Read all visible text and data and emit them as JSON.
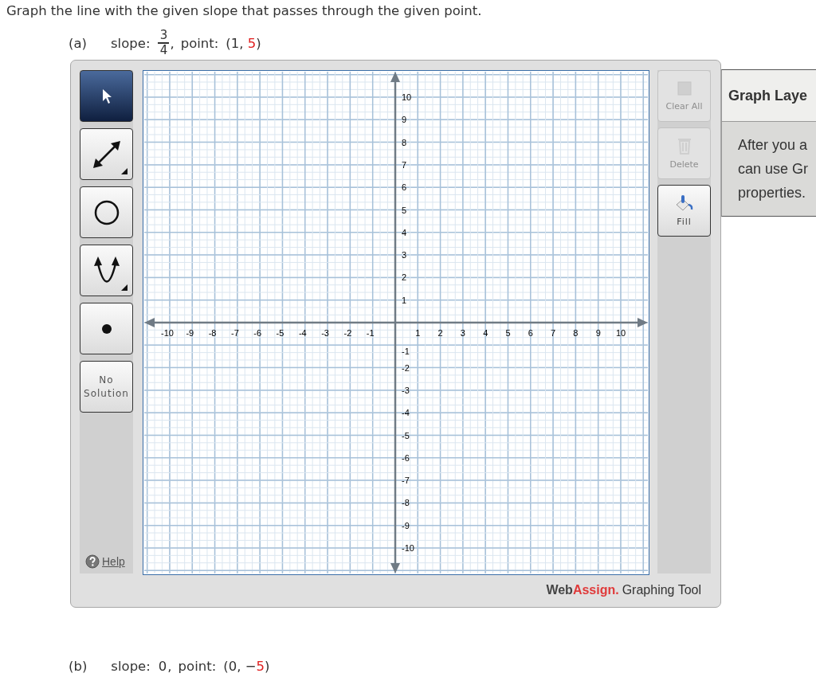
{
  "instruction": "Graph the line with the given slope that passes through the given point.",
  "parts": [
    {
      "label": "(a)",
      "slope_label": "slope:",
      "slope": {
        "kind": "fraction",
        "numerator": "3",
        "denominator": "4"
      },
      "separator": ",",
      "point_label": "point:",
      "point": {
        "open": "(1, ",
        "highlight": "5",
        "close": ")"
      }
    },
    {
      "label": "(b)",
      "slope_label": "slope:",
      "slope": {
        "kind": "number",
        "text": "0"
      },
      "separator": ",",
      "point_label": "point:",
      "point": {
        "open": "(0, −",
        "highlight": "5",
        "close": ")"
      }
    }
  ],
  "tool": {
    "tools": [
      {
        "kind": "pointer",
        "selected": true,
        "has_menu": false
      },
      {
        "kind": "line",
        "selected": false,
        "has_menu": true
      },
      {
        "kind": "circle",
        "selected": false,
        "has_menu": false
      },
      {
        "kind": "parabola",
        "selected": false,
        "has_menu": true
      },
      {
        "kind": "point",
        "selected": false,
        "has_menu": false
      },
      {
        "kind": "text",
        "label": "No Solution",
        "selected": false,
        "has_menu": false
      }
    ],
    "help": "Help",
    "actions": [
      {
        "kind": "clear",
        "label": "Clear All",
        "disabled": true
      },
      {
        "kind": "delete",
        "label": "Delete",
        "disabled": true
      },
      {
        "kind": "fill",
        "label": "Fill",
        "disabled": false
      }
    ],
    "x_tick_labels": [
      "-10",
      "-9",
      "-8",
      "-7",
      "-6",
      "-5",
      "-4",
      "-3",
      "-2",
      "-1",
      "1",
      "2",
      "3",
      "4",
      "5",
      "6",
      "7",
      "8",
      "9",
      "10"
    ],
    "y_tick_labels": [
      "10",
      "9",
      "8",
      "7",
      "6",
      "5",
      "4",
      "3",
      "2",
      "1",
      "-1",
      "-2",
      "-3",
      "-4",
      "-5",
      "-6",
      "-7",
      "-8",
      "-9",
      "-10"
    ],
    "brand": {
      "first": "Web",
      "second": "Assign.",
      "product": "Graphing Tool"
    },
    "layers_panel": {
      "title": "Graph Laye",
      "lines": [
        "After you a",
        "can use Gr",
        "properties."
      ]
    }
  }
}
